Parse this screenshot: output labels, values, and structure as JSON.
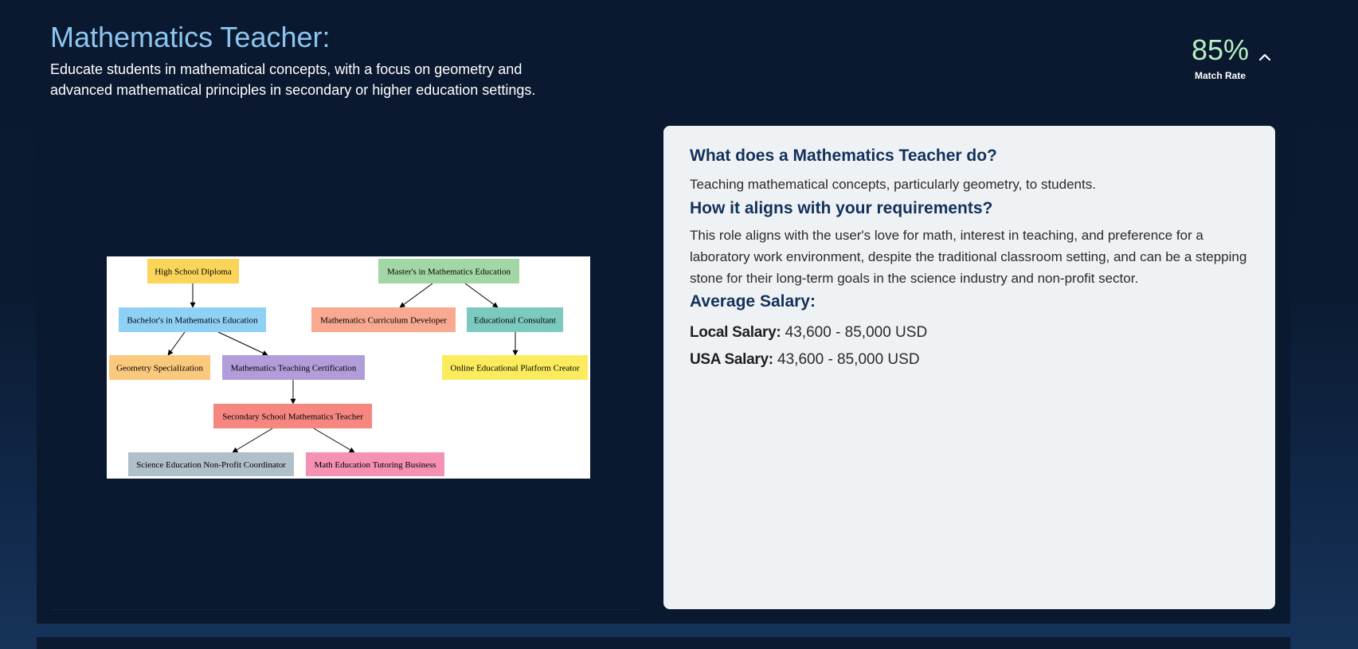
{
  "job": {
    "title": "Mathematics Teacher:",
    "description": "Educate students in mathematical concepts, with a focus on geometry and advanced mathematical principles in secondary or higher education settings."
  },
  "match": {
    "value": "85%",
    "label": "Match Rate",
    "toggle_icon": "chevron-up-icon"
  },
  "diagram": {
    "nodes": [
      {
        "id": "hs",
        "label": "High School Diploma",
        "color": "#fbd45a"
      },
      {
        "id": "ms",
        "label": "Master's in Mathematics Education",
        "color": "#a3d6a5"
      },
      {
        "id": "bs",
        "label": "Bachelor's in Mathematics Education",
        "color": "#8fd1f5"
      },
      {
        "id": "mcd",
        "label": "Mathematics Curriculum Developer",
        "color": "#f8a98f"
      },
      {
        "id": "ec",
        "label": "Educational Consultant",
        "color": "#7cc9c0"
      },
      {
        "id": "gs",
        "label": "Geometry Specialization",
        "color": "#fbc97d"
      },
      {
        "id": "mtc",
        "label": "Mathematics Teaching Certification",
        "color": "#b29ddb"
      },
      {
        "id": "oepc",
        "label": "Online Educational Platform Creator",
        "color": "#fbec5e"
      },
      {
        "id": "ssmt",
        "label": "Secondary School Mathematics Teacher",
        "color": "#f58780"
      },
      {
        "id": "sen",
        "label": "Science Education Non-Profit Coordinator",
        "color": "#b1bfc8"
      },
      {
        "id": "metb",
        "label": "Math Education Tutoring Business",
        "color": "#f592b3"
      }
    ],
    "edges": [
      {
        "from": "hs",
        "to": "bs"
      },
      {
        "from": "ms",
        "to": "mcd"
      },
      {
        "from": "ms",
        "to": "ec"
      },
      {
        "from": "bs",
        "to": "gs"
      },
      {
        "from": "bs",
        "to": "mtc"
      },
      {
        "from": "ec",
        "to": "oepc"
      },
      {
        "from": "mtc",
        "to": "ssmt"
      },
      {
        "from": "ssmt",
        "to": "sen"
      },
      {
        "from": "ssmt",
        "to": "metb"
      }
    ]
  },
  "info": {
    "what_heading": "What does a Mathematics Teacher do?",
    "what_text": "Teaching mathematical concepts, particularly geometry, to students.",
    "align_heading": "How it aligns with your requirements?",
    "align_text": "This role aligns with the user's love for math, interest in teaching, and preference for a laboratory work environment, despite the traditional classroom setting, and can be a stepping stone for their long-term goals in the science industry and non-profit sector.",
    "salary_heading": "Average Salary:",
    "local_salary_label": "Local Salary:",
    "local_salary_value": "43,600 - 85,000 USD",
    "usa_salary_label": "USA Salary:",
    "usa_salary_value": "43,600 - 85,000 USD"
  }
}
